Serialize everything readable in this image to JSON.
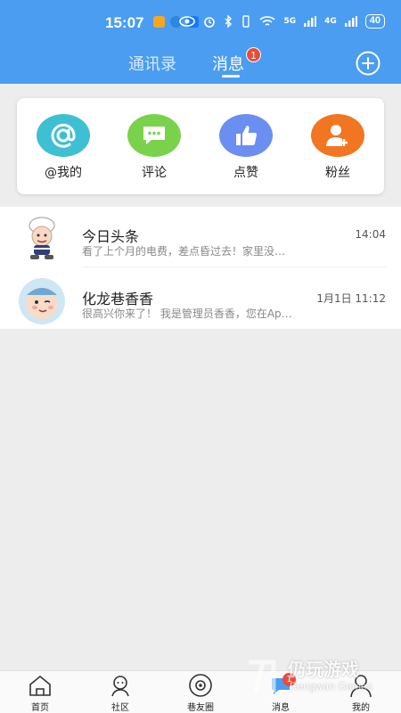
{
  "status_bar": {
    "time": "15:07",
    "network_left": "5G",
    "network_right": "4G",
    "battery": "40"
  },
  "header": {
    "tabs": [
      {
        "label": "通讯录",
        "active": false
      },
      {
        "label": "消息",
        "active": true,
        "badge": "1"
      }
    ],
    "add_icon": "plus-circle-icon"
  },
  "quick_actions": [
    {
      "label": "@我的",
      "icon": "at-icon",
      "color": "#3fbfd3"
    },
    {
      "label": "评论",
      "icon": "comment-icon",
      "color": "#7ad24c"
    },
    {
      "label": "点赞",
      "icon": "thumbs-up-icon",
      "color": "#6b8ff0"
    },
    {
      "label": "粉丝",
      "icon": "add-user-icon",
      "color": "#f27522"
    }
  ],
  "messages": [
    {
      "title": "今日头条",
      "time": "14:04",
      "preview": "看了上个月的电费，差点昏过去！家里没…",
      "avatar": "chef-avatar-icon"
    },
    {
      "title": "化龙巷香香",
      "time": "1月1日 11:12",
      "preview": "很高兴你来了！ 我是管理员香香，您在Ap…",
      "avatar": "baby-avatar-icon"
    }
  ],
  "bottom_nav": [
    {
      "label": "首页",
      "icon": "home-icon"
    },
    {
      "label": "社区",
      "icon": "community-icon"
    },
    {
      "label": "巷友圈",
      "icon": "friends-circle-icon"
    },
    {
      "label": "消息",
      "icon": "message-icon",
      "badge": "1",
      "active": true
    },
    {
      "label": "我的",
      "icon": "profile-icon"
    }
  ],
  "watermark": {
    "brand": "仍玩游戏",
    "sub": "Rengwan Games"
  }
}
